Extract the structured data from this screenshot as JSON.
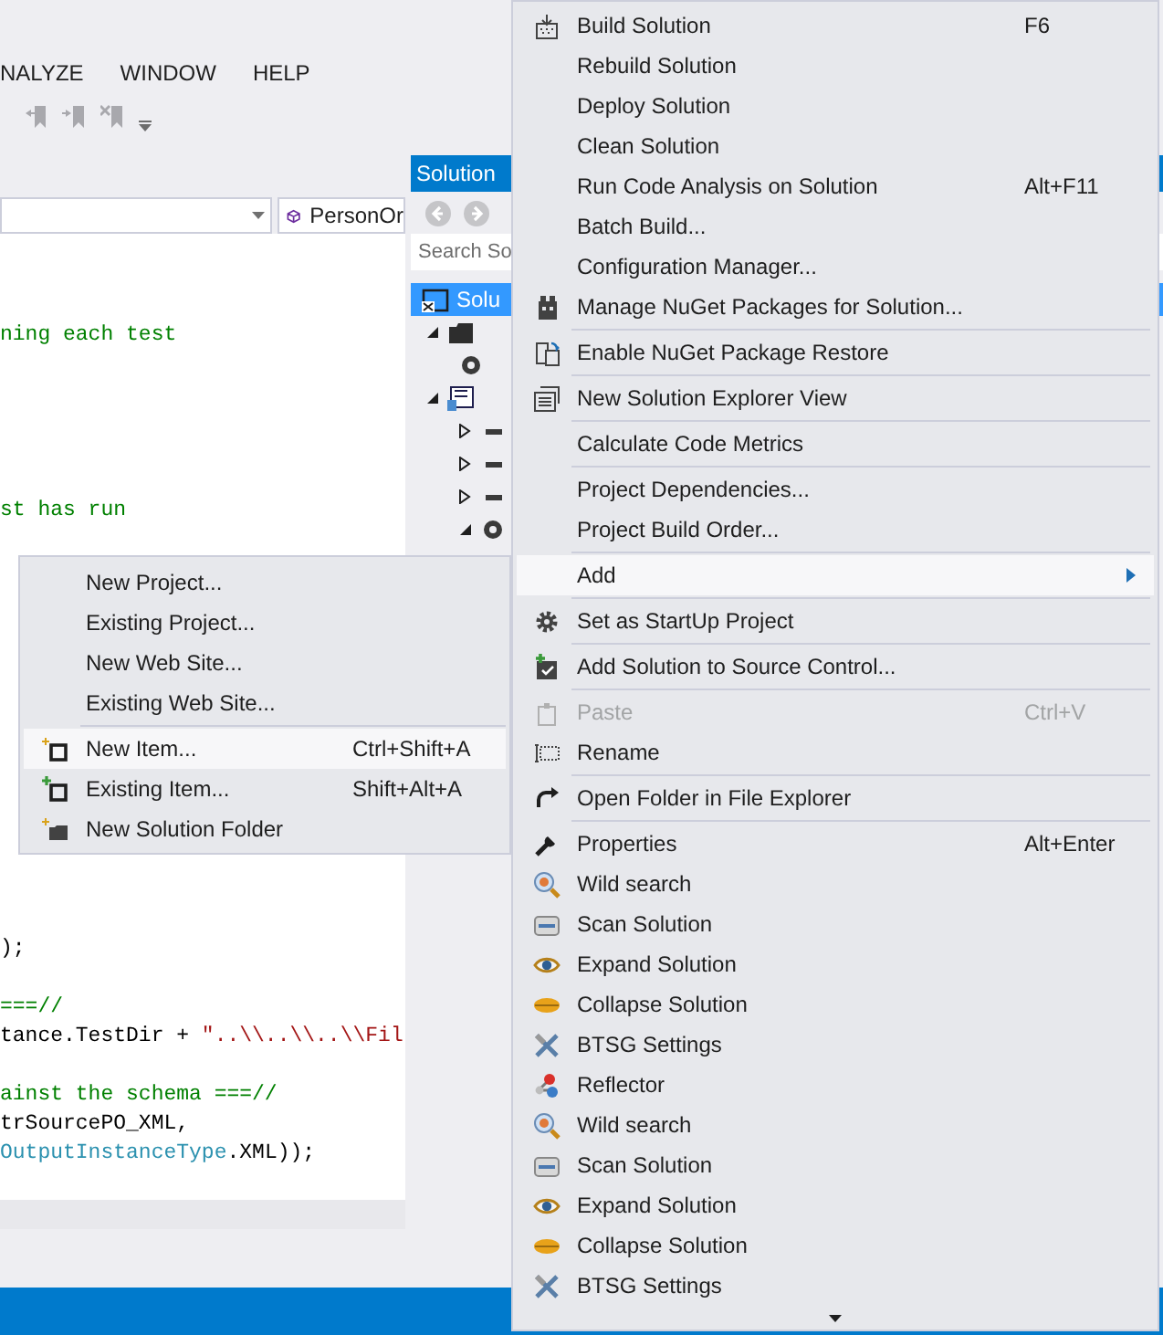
{
  "menu_bar": [
    "NALYZE",
    "WINDOW",
    "HELP"
  ],
  "editor": {
    "member_dropdown": "PersonOr",
    "lines": [
      {
        "kind": "blank"
      },
      {
        "kind": "blank"
      },
      {
        "kind": "blank"
      },
      {
        "kind": "code",
        "segments": [
          {
            "text": "ning each test",
            "kind": "comment"
          }
        ]
      },
      {
        "kind": "blank"
      },
      {
        "kind": "blank"
      },
      {
        "kind": "blank"
      },
      {
        "kind": "blank"
      },
      {
        "kind": "blank"
      },
      {
        "kind": "code",
        "segments": [
          {
            "text": "st has run",
            "kind": "comment"
          }
        ]
      },
      {
        "kind": "blank"
      },
      {
        "kind": "blank"
      },
      {
        "kind": "blank"
      },
      {
        "kind": "blank"
      },
      {
        "kind": "blank"
      },
      {
        "kind": "blank"
      },
      {
        "kind": "blank"
      },
      {
        "kind": "blank"
      },
      {
        "kind": "blank"
      },
      {
        "kind": "blank"
      },
      {
        "kind": "blank"
      },
      {
        "kind": "blank"
      },
      {
        "kind": "blank"
      },
      {
        "kind": "blank"
      },
      {
        "kind": "code",
        "segments": [
          {
            "text": ");",
            "kind": "plain"
          }
        ]
      },
      {
        "kind": "blank"
      },
      {
        "kind": "code",
        "segments": [
          {
            "text": "===//",
            "kind": "comment"
          }
        ]
      },
      {
        "kind": "code",
        "segments": [
          {
            "text": "tance.TestDir + ",
            "kind": "plain"
          },
          {
            "text": "\"..\\\\..\\\\..\\\\Fil",
            "kind": "string"
          }
        ]
      },
      {
        "kind": "blank"
      },
      {
        "kind": "code",
        "segments": [
          {
            "text": "ainst the schema ===//",
            "kind": "comment"
          }
        ]
      },
      {
        "kind": "code",
        "segments": [
          {
            "text": "trSourcePO_XML,",
            "kind": "plain"
          }
        ]
      },
      {
        "kind": "code",
        "segments": [
          {
            "text": "OutputInstanceType",
            "kind": "type"
          },
          {
            "text": ".XML));",
            "kind": "plain"
          }
        ]
      }
    ]
  },
  "solution_explorer": {
    "title": "Solution",
    "search": {
      "placeholder": "Search So"
    },
    "tree": [
      {
        "label": "Solu",
        "selected": true,
        "children": [
          {
            "selected": false,
            "expanded": true,
            "children": [
              {
                "selected": false
              }
            ]
          },
          {
            "selected": false,
            "expanded": true,
            "children": [
              {
                "selected": false,
                "expanded": false
              },
              {
                "selected": false,
                "expanded": false
              },
              {
                "selected": false,
                "expanded": false
              },
              {
                "selected": false,
                "expanded": true
              }
            ]
          }
        ]
      }
    ]
  },
  "context_menu": {
    "items": [
      {
        "kind": "item",
        "label": "Build Solution",
        "shortcut": "F6",
        "selected": false,
        "disabled": false
      },
      {
        "kind": "item",
        "label": "Rebuild Solution",
        "selected": false,
        "disabled": false
      },
      {
        "kind": "item",
        "label": "Deploy Solution",
        "selected": false,
        "disabled": false
      },
      {
        "kind": "item",
        "label": "Clean Solution",
        "selected": false,
        "disabled": false
      },
      {
        "kind": "item",
        "label": "Run Code Analysis on Solution",
        "shortcut": "Alt+F11",
        "selected": false,
        "disabled": false
      },
      {
        "kind": "item",
        "label": "Batch Build...",
        "selected": false,
        "disabled": false
      },
      {
        "kind": "item",
        "label": "Configuration Manager...",
        "selected": false,
        "disabled": false
      },
      {
        "kind": "item",
        "label": "Manage NuGet Packages for Solution...",
        "selected": false,
        "disabled": false
      },
      {
        "kind": "separator"
      },
      {
        "kind": "item",
        "label": "Enable NuGet Package Restore",
        "selected": false,
        "disabled": false
      },
      {
        "kind": "separator"
      },
      {
        "kind": "item",
        "label": "New Solution Explorer View",
        "selected": false,
        "disabled": false
      },
      {
        "kind": "separator"
      },
      {
        "kind": "item",
        "label": "Calculate Code Metrics",
        "selected": false,
        "disabled": false
      },
      {
        "kind": "separator"
      },
      {
        "kind": "item",
        "label": "Project Dependencies...",
        "selected": false,
        "disabled": false
      },
      {
        "kind": "item",
        "label": "Project Build Order...",
        "selected": false,
        "disabled": false
      },
      {
        "kind": "separator"
      },
      {
        "kind": "item",
        "label": "Add",
        "selected": true,
        "disabled": false,
        "submenu": true
      },
      {
        "kind": "separator"
      },
      {
        "kind": "item",
        "label": "Set as StartUp Project",
        "selected": false,
        "disabled": false
      },
      {
        "kind": "separator"
      },
      {
        "kind": "item",
        "label": "Add Solution to Source Control...",
        "selected": false,
        "disabled": false
      },
      {
        "kind": "separator"
      },
      {
        "kind": "item",
        "label": "Paste",
        "shortcut": "Ctrl+V",
        "selected": false,
        "disabled": true
      },
      {
        "kind": "item",
        "label": "Rename",
        "selected": false,
        "disabled": false
      },
      {
        "kind": "separator"
      },
      {
        "kind": "item",
        "label": "Open Folder in File Explorer",
        "selected": false,
        "disabled": false
      },
      {
        "kind": "separator"
      },
      {
        "kind": "item",
        "label": "Properties",
        "shortcut": "Alt+Enter",
        "selected": false,
        "disabled": false
      },
      {
        "kind": "item",
        "label": "Wild search",
        "selected": false,
        "disabled": false
      },
      {
        "kind": "item",
        "label": "Scan Solution",
        "selected": false,
        "disabled": false
      },
      {
        "kind": "item",
        "label": "Expand Solution",
        "selected": false,
        "disabled": false
      },
      {
        "kind": "item",
        "label": "Collapse Solution",
        "selected": false,
        "disabled": false
      },
      {
        "kind": "item",
        "label": "BTSG Settings",
        "selected": false,
        "disabled": false
      },
      {
        "kind": "item",
        "label": "Reflector",
        "selected": false,
        "disabled": false
      },
      {
        "kind": "item",
        "label": "Wild search",
        "selected": false,
        "disabled": false
      },
      {
        "kind": "item",
        "label": "Scan Solution",
        "selected": false,
        "disabled": false
      },
      {
        "kind": "item",
        "label": "Expand Solution",
        "selected": false,
        "disabled": false
      },
      {
        "kind": "item",
        "label": "Collapse Solution",
        "selected": false,
        "disabled": false
      },
      {
        "kind": "item",
        "label": "BTSG Settings",
        "selected": false,
        "disabled": false
      }
    ]
  },
  "add_submenu": {
    "items": [
      {
        "kind": "item",
        "label": "New Project...",
        "selected": false
      },
      {
        "kind": "item",
        "label": "Existing Project...",
        "selected": false
      },
      {
        "kind": "item",
        "label": "New Web Site...",
        "selected": false
      },
      {
        "kind": "item",
        "label": "Existing Web Site...",
        "selected": false
      },
      {
        "kind": "separator"
      },
      {
        "kind": "item",
        "label": "New Item...",
        "shortcut": "Ctrl+Shift+A",
        "selected": true
      },
      {
        "kind": "item",
        "label": "Existing Item...",
        "shortcut": "Shift+Alt+A",
        "selected": false
      },
      {
        "kind": "item",
        "label": "New Solution Folder",
        "selected": false
      }
    ]
  }
}
